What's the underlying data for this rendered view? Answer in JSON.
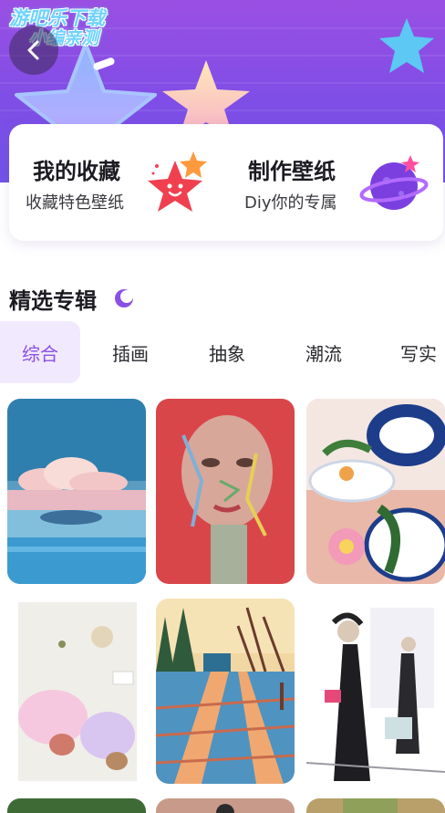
{
  "watermark": {
    "line1": "游吧乐下载",
    "line2": "小编亲测"
  },
  "cards": [
    {
      "title": "我的收藏",
      "subtitle": "收藏特色壁纸",
      "icon": "smiling-star-icon"
    },
    {
      "title": "制作壁纸",
      "subtitle": "Diy你的专属",
      "icon": "planet-icon"
    }
  ],
  "section": {
    "title": "精选专辑",
    "icon": "crescent-moon-icon"
  },
  "tabs": [
    {
      "label": "综合",
      "active": true
    },
    {
      "label": "插画",
      "active": false
    },
    {
      "label": "抽象",
      "active": false
    },
    {
      "label": "潮流",
      "active": false
    },
    {
      "label": "写实",
      "active": false
    }
  ],
  "wallpapers": [
    {
      "name": "whale-sea-sky"
    },
    {
      "name": "painted-face-portrait"
    },
    {
      "name": "blue-porcelain-bowls"
    },
    {
      "name": "abstract-watercolor"
    },
    {
      "name": "snowy-road-sunset"
    },
    {
      "name": "ink-sketch-figures"
    }
  ],
  "colors": {
    "accent": "#8a4fe6",
    "hero_top": "#9a4fe3",
    "hero_bottom": "#6f52e8",
    "tab_active_bg": "#f1e9fe"
  }
}
